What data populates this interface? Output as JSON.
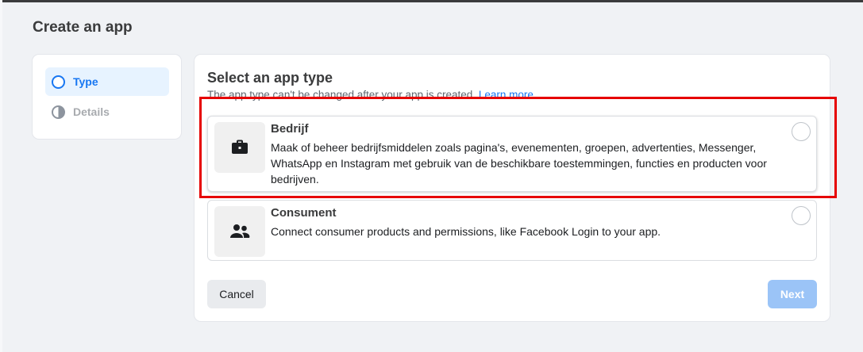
{
  "dialog": {
    "title": "Create an app"
  },
  "stepper": {
    "steps": [
      {
        "label": "Type",
        "state": "active"
      },
      {
        "label": "Details",
        "state": "inactive"
      }
    ]
  },
  "main": {
    "title": "Select an app type",
    "subtitle": "The app type can't be changed after your app is created.",
    "learn_more": "Learn more",
    "options": [
      {
        "icon": "briefcase-icon",
        "title": "Bedrijf",
        "description": "Maak of beheer bedrijfsmiddelen zoals pagina's, evenementen, groepen, advertenties, Messenger, WhatsApp en Instagram met gebruik van de beschikbare toestemmingen, functies en producten voor bedrijven.",
        "selected": false
      },
      {
        "icon": "people-icon",
        "title": "Consument",
        "description": "Connect consumer products and permissions, like Facebook Login to your app.",
        "selected": false
      }
    ],
    "buttons": {
      "cancel": "Cancel",
      "next": "Next"
    }
  },
  "colors": {
    "accent": "#1877f2",
    "next_disabled": "#9bc4f7",
    "highlight": "#e60000",
    "background": "#f0f2f5"
  }
}
